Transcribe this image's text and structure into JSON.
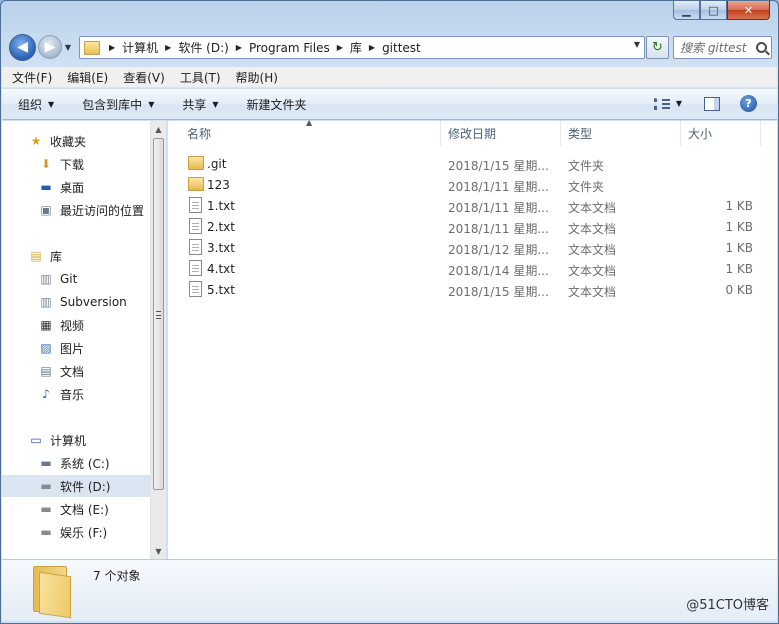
{
  "window": {
    "minimize_glyph": "▁",
    "maximize_glyph": "□",
    "close_glyph": "✕"
  },
  "nav": {
    "back_glyph": "◀",
    "forward_glyph": "▶",
    "history_glyph": "▼",
    "breadcrumbs": [
      "计算机",
      "软件 (D:)",
      "Program Files",
      "库",
      "gittest"
    ],
    "refresh_glyph": "↻",
    "search_placeholder": "搜索 gittest"
  },
  "menu": [
    "文件(F)",
    "编辑(E)",
    "查看(V)",
    "工具(T)",
    "帮助(H)"
  ],
  "commands": {
    "organize": "组织",
    "include_in_library": "包含到库中",
    "share": "共享",
    "new_folder": "新建文件夹",
    "help_glyph": "?"
  },
  "sidebar": {
    "favorites": {
      "label": "收藏夹",
      "icon": "star-icon",
      "glyph": "★",
      "color": "#d8a31a"
    },
    "favorite_items": [
      {
        "label": "下载",
        "icon": "downloads-icon",
        "glyph": "⬇",
        "color": "#d09b2c"
      },
      {
        "label": "桌面",
        "icon": "desktop-icon",
        "glyph": "▬",
        "color": "#2b5ca8"
      },
      {
        "label": "最近访问的位置",
        "icon": "recent-places-icon",
        "glyph": "▣",
        "color": "#6a7a8c"
      }
    ],
    "libraries": {
      "label": "库",
      "icon": "libraries-icon",
      "glyph": "▤",
      "color": "#d8a83a"
    },
    "library_items": [
      {
        "label": "Git",
        "icon": "git-library-icon",
        "glyph": "▥",
        "color": "#7a8796"
      },
      {
        "label": "Subversion",
        "icon": "subversion-library-icon",
        "glyph": "▥",
        "color": "#7a8796"
      },
      {
        "label": "视频",
        "icon": "videos-icon",
        "glyph": "▦",
        "color": "#333333"
      },
      {
        "label": "图片",
        "icon": "pictures-icon",
        "glyph": "▨",
        "color": "#3b6fb4"
      },
      {
        "label": "文档",
        "icon": "documents-icon",
        "glyph": "▤",
        "color": "#6a7a8c"
      },
      {
        "label": "音乐",
        "icon": "music-icon",
        "glyph": "♪",
        "color": "#2a62b6"
      }
    ],
    "computer": {
      "label": "计算机",
      "icon": "computer-icon",
      "glyph": "▭",
      "color": "#2b5ca8"
    },
    "drives": [
      {
        "label": "系统 (C:)",
        "icon": "system-drive-icon",
        "glyph": "▬",
        "color": "#6b7a8a",
        "selected": false
      },
      {
        "label": "软件 (D:)",
        "icon": "drive-icon",
        "glyph": "▬",
        "color": "#8a8a8a",
        "selected": true
      },
      {
        "label": "文档 (E:)",
        "icon": "drive-icon",
        "glyph": "▬",
        "color": "#8a8a8a",
        "selected": false
      },
      {
        "label": "娱乐 (F:)",
        "icon": "drive-icon",
        "glyph": "▬",
        "color": "#8a8a8a",
        "selected": false
      }
    ],
    "scroll_up": "▲",
    "scroll_down": "▼"
  },
  "columns": {
    "name": "名称",
    "modified": "修改日期",
    "type": "类型",
    "size": "大小"
  },
  "sort_glyph": "▲",
  "files": [
    {
      "name": ".git",
      "modified": "2018/1/15 星期...",
      "type": "文件夹",
      "size": "",
      "kind": "folder"
    },
    {
      "name": "123",
      "modified": "2018/1/11 星期...",
      "type": "文件夹",
      "size": "",
      "kind": "folder"
    },
    {
      "name": "1.txt",
      "modified": "2018/1/11 星期...",
      "type": "文本文档",
      "size": "1 KB",
      "kind": "file"
    },
    {
      "name": "2.txt",
      "modified": "2018/1/11 星期...",
      "type": "文本文档",
      "size": "1 KB",
      "kind": "file"
    },
    {
      "name": "3.txt",
      "modified": "2018/1/12 星期...",
      "type": "文本文档",
      "size": "1 KB",
      "kind": "file"
    },
    {
      "name": "4.txt",
      "modified": "2018/1/14 星期...",
      "type": "文本文档",
      "size": "1 KB",
      "kind": "file"
    },
    {
      "name": "5.txt",
      "modified": "2018/1/15 星期...",
      "type": "文本文档",
      "size": "0 KB",
      "kind": "file"
    }
  ],
  "details": {
    "object_count": "7 个对象"
  },
  "watermark": "@51CTO博客"
}
